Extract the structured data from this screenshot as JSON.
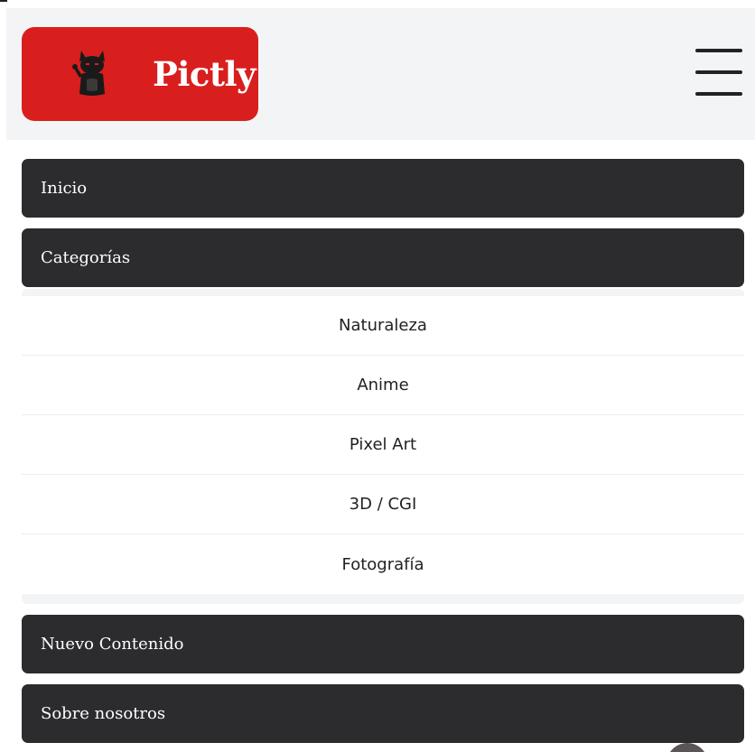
{
  "header": {
    "logo_text": "Pictly",
    "logo_color": "#d91e1e",
    "menu_icon": "hamburger-icon"
  },
  "nav": {
    "inicio": "Inicio",
    "categorias": "Categorías",
    "nuevo_contenido": "Nuevo Contenido",
    "sobre_nosotros": "Sobre nosotros"
  },
  "categories": {
    "items": [
      {
        "label": "Naturaleza"
      },
      {
        "label": "Anime"
      },
      {
        "label": "Pixel Art"
      },
      {
        "label": "3D / CGI"
      },
      {
        "label": "Fotografía"
      }
    ]
  },
  "colors": {
    "menu_bg": "#2c2b2d",
    "header_bg": "#f3f4f6"
  },
  "scroll_button_icon": "scroll-top-icon"
}
